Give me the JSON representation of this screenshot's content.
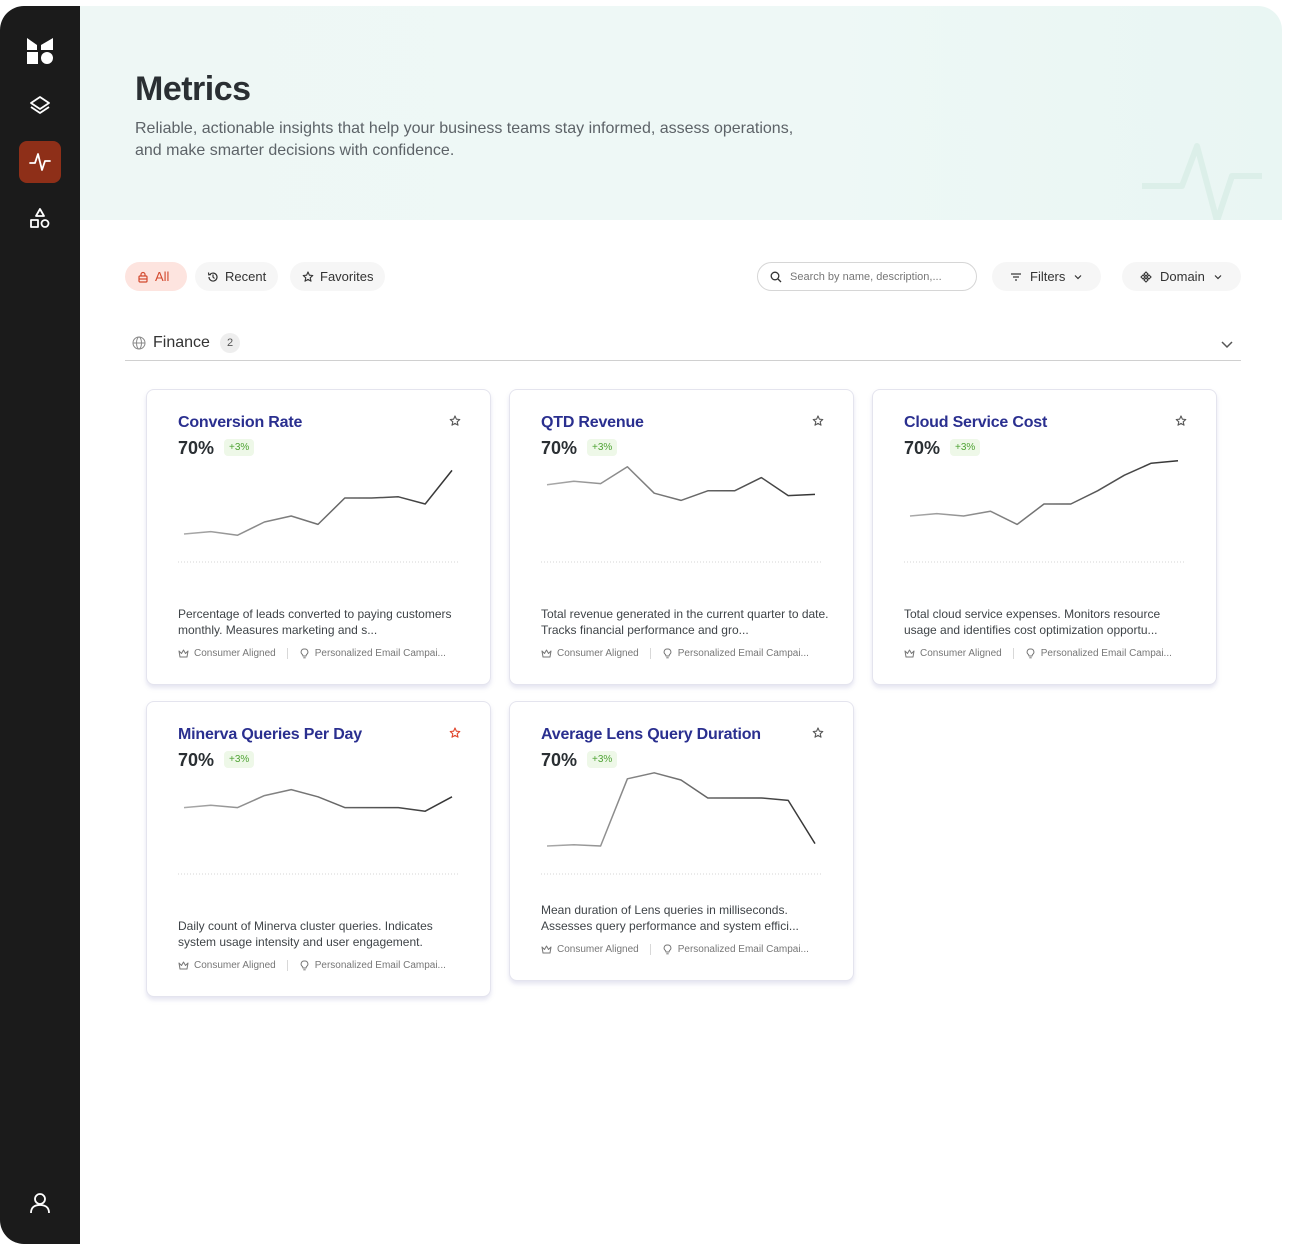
{
  "nav": {
    "items": [
      {
        "name": "logo-icon",
        "active": false
      },
      {
        "name": "layers-icon",
        "active": false
      },
      {
        "name": "pulse-icon",
        "active": true
      },
      {
        "name": "shapes-icon",
        "active": false
      }
    ],
    "profile_icon": "user-icon"
  },
  "header": {
    "title": "Metrics",
    "description": "Reliable, actionable insights that help your business teams stay informed, assess operations, and make smarter decisions with confidence."
  },
  "toolbar": {
    "tabs": [
      {
        "label": "All",
        "icon": "lock-icon",
        "active": true
      },
      {
        "label": "Recent",
        "icon": "history-icon",
        "active": false
      },
      {
        "label": "Favorites",
        "icon": "star-icon",
        "active": false
      }
    ],
    "search_placeholder": "Search by name, description,...",
    "filters_label": "Filters",
    "domain_label": "Domain"
  },
  "group": {
    "title": "Finance",
    "count": "2"
  },
  "cards": [
    {
      "title": "Conversion Rate",
      "value": "70%",
      "delta": "+3%",
      "favorited": false,
      "series": [
        10,
        12,
        9,
        20,
        25,
        18,
        40,
        40,
        41,
        35,
        63
      ],
      "description": "Percentage of leads converted to paying customers monthly. Measures marketing and s...",
      "tag1": "Consumer Aligned",
      "tag2": "Personalized Email Campai..."
    },
    {
      "title": "QTD Revenue",
      "value": "70%",
      "delta": "+3%",
      "favorited": false,
      "series": [
        51,
        54,
        52,
        66,
        44,
        38,
        46,
        46,
        57,
        42,
        43
      ],
      "description": "Total revenue generated in the current quarter to date. Tracks financial performance and gro...",
      "tag1": "Consumer Aligned",
      "tag2": "Personalized Email Campai..."
    },
    {
      "title": "Cloud Service Cost",
      "value": "70%",
      "delta": "+3%",
      "favorited": false,
      "series": [
        25,
        27,
        25,
        29,
        18,
        35,
        35,
        46,
        59,
        69,
        71
      ],
      "description": "Total cloud service expenses. Monitors resource usage and identifies cost optimization opportu...",
      "tag1": "Consumer Aligned",
      "tag2": "Personalized Email Campai..."
    },
    {
      "title": "Minerva Queries Per Day",
      "value": "70%",
      "delta": "+3%",
      "favorited": true,
      "series": [
        42,
        44,
        42,
        52,
        57,
        51,
        42,
        42,
        42,
        39,
        51
      ],
      "description": "Daily count of Minerva cluster queries. Indicates system usage intensity and user engagement.",
      "tag1": "Consumer Aligned",
      "tag2": "Personalized Email Campai..."
    },
    {
      "title": "Average Lens Query Duration",
      "value": "70%",
      "delta": "+3%",
      "favorited": false,
      "series": [
        10,
        11,
        10,
        66,
        71,
        65,
        50,
        50,
        50,
        48,
        12
      ],
      "description": "Mean duration of Lens queries in milliseconds. Assesses query performance and system effici...",
      "tag1": "Consumer Aligned",
      "tag2": "Personalized Email Campai..."
    }
  ],
  "colors": {
    "accent": "#8e2f18",
    "title_blue": "#2a2f8f",
    "positive": "#4fa334",
    "favorite": "#e0442a"
  }
}
